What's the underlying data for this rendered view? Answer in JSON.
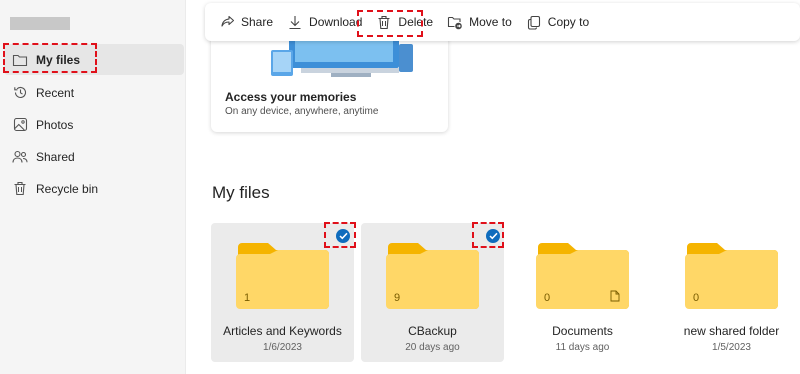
{
  "sidebar": {
    "items": [
      {
        "label": "My files",
        "icon": "folder-icon",
        "active": true
      },
      {
        "label": "Recent",
        "icon": "recent-icon"
      },
      {
        "label": "Photos",
        "icon": "photos-icon"
      },
      {
        "label": "Shared",
        "icon": "shared-icon"
      },
      {
        "label": "Recycle bin",
        "icon": "recycle-bin-icon"
      }
    ]
  },
  "toolbar": {
    "share": "Share",
    "download": "Download",
    "delete": "Delete",
    "move_to": "Move to",
    "copy_to": "Copy to"
  },
  "memories": {
    "title": "Access your memories",
    "subtitle": "On any device, anywhere, anytime"
  },
  "section": {
    "title": "My files"
  },
  "files": [
    {
      "name": "Articles and Keywords",
      "date": "1/6/2023",
      "count": "1",
      "selected": true
    },
    {
      "name": "CBackup",
      "date": "20 days ago",
      "count": "9",
      "selected": true
    },
    {
      "name": "Documents",
      "date": "11 days ago",
      "count": "0",
      "selected": false,
      "badge": "document-icon"
    },
    {
      "name": "new shared folder",
      "date": "1/5/2023",
      "count": "0",
      "selected": false
    }
  ],
  "colors": {
    "accent": "#0f6cbd",
    "folder_front": "#ffd767",
    "folder_back": "#f5b400",
    "highlight": "#e0101a"
  }
}
